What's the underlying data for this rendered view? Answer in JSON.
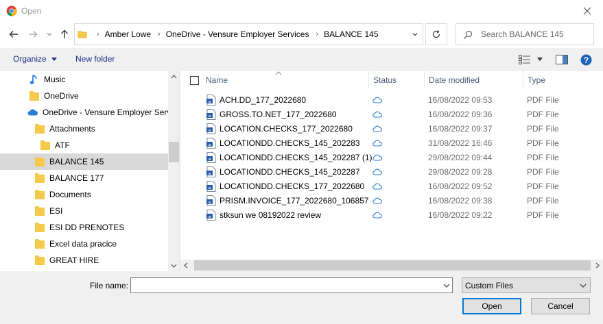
{
  "window": {
    "title": "Open"
  },
  "address": {
    "crumbs": [
      "Amber Lowe",
      "OneDrive - Vensure Employer Services",
      "BALANCE 145"
    ],
    "search_placeholder": "Search BALANCE 145"
  },
  "toolbar": {
    "organize": "Organize",
    "new_folder": "New folder"
  },
  "nav": {
    "items": [
      {
        "label": "Music",
        "icon": "music-icon"
      },
      {
        "label": "OneDrive",
        "icon": "folder-icon"
      },
      {
        "label": "OneDrive - Vensure Employer Services",
        "icon": "cloud-icon"
      },
      {
        "label": "Attachments",
        "icon": "folder-icon"
      },
      {
        "label": "ATF",
        "icon": "folder-icon"
      },
      {
        "label": "BALANCE 145",
        "icon": "folder-icon",
        "selected": true
      },
      {
        "label": "BALANCE 177",
        "icon": "folder-icon"
      },
      {
        "label": "Documents",
        "icon": "folder-icon"
      },
      {
        "label": "ESI",
        "icon": "folder-icon"
      },
      {
        "label": "ESI DD PRENOTES",
        "icon": "folder-icon"
      },
      {
        "label": "Excel data pracice",
        "icon": "folder-icon"
      },
      {
        "label": "GREAT HIRE",
        "icon": "folder-icon"
      }
    ]
  },
  "columns": {
    "name": "Name",
    "status": "Status",
    "date": "Date modified",
    "type": "Type"
  },
  "files": [
    {
      "name": "ACH.DD_177_2022680",
      "date": "16/08/2022 09:53",
      "type": "PDF File"
    },
    {
      "name": "GROSS.TO.NET_177_2022680",
      "date": "16/08/2022 09:36",
      "type": "PDF File"
    },
    {
      "name": "LOCATION.CHECKS_177_2022680",
      "date": "16/08/2022 09:37",
      "type": "PDF File"
    },
    {
      "name": "LOCATIONDD.CHECKS_145_202283",
      "date": "31/08/2022 16:46",
      "type": "PDF File"
    },
    {
      "name": "LOCATIONDD.CHECKS_145_202287 (1)",
      "date": "29/08/2022 09:44",
      "type": "PDF File"
    },
    {
      "name": "LOCATIONDD.CHECKS_145_202287",
      "date": "29/08/2022 09:28",
      "type": "PDF File"
    },
    {
      "name": "LOCATIONDD.CHECKS_177_2022680",
      "date": "16/08/2022 09:52",
      "type": "PDF File"
    },
    {
      "name": "PRISM.INVOICE_177_2022680_106857",
      "date": "16/08/2022 09:38",
      "type": "PDF File"
    },
    {
      "name": "stksun we 08192022 review",
      "date": "16/08/2022 09:22",
      "type": "PDF File"
    }
  ],
  "bottom": {
    "file_name_label": "File name:",
    "file_name_value": "",
    "filter": "Custom Files",
    "open": "Open",
    "cancel": "Cancel"
  },
  "colors": {
    "folder": "#f5c94a",
    "accent": "#0078d7",
    "cloud": "#2b7cd3"
  }
}
